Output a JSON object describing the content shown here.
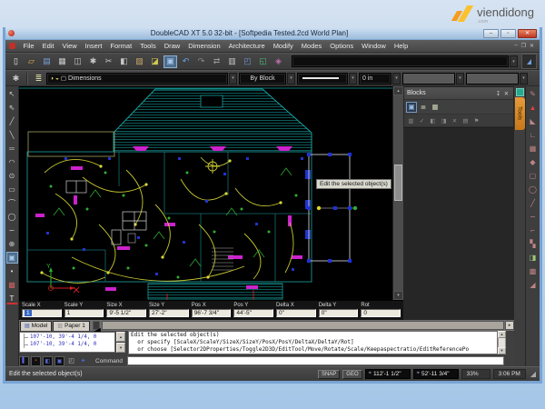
{
  "branding": {
    "name": "viendidong",
    "domain": ".com"
  },
  "window": {
    "title": "DoubleCAD XT 5.0 32-bit - [Softpedia Tested.2cd World Plan]"
  },
  "ui": {
    "up": "▴",
    "down": "▾",
    "left": "◂",
    "right": "▸",
    "grip": "◢",
    "coord_icon": "⌖",
    "pin": "↧",
    "close": "✕",
    "win_min": "–",
    "win_max": "▫",
    "win_close": "✕",
    "mdi_min": "–",
    "mdi_restore": "❐",
    "mdi_close": "✕",
    "dropdown": "▾"
  },
  "menu": {
    "items": [
      "File",
      "Edit",
      "View",
      "Insert",
      "Format",
      "Tools",
      "Draw",
      "Dimension",
      "Architecture",
      "Modify",
      "Modes",
      "Options",
      "Window",
      "Help"
    ]
  },
  "toolbar_main": {
    "icons": [
      {
        "name": "new",
        "glyph": "▯"
      },
      {
        "name": "open",
        "glyph": "▱"
      },
      {
        "name": "save",
        "glyph": "▤"
      },
      {
        "name": "print",
        "glyph": "▦"
      },
      {
        "name": "print-preview",
        "glyph": "◫"
      },
      {
        "name": "settings",
        "glyph": "✱"
      },
      {
        "name": "cut",
        "glyph": "✂"
      },
      {
        "name": "copy",
        "glyph": "◧"
      },
      {
        "name": "paste",
        "glyph": "▨"
      },
      {
        "name": "format-brush",
        "glyph": "◪"
      },
      {
        "name": "image",
        "glyph": "▣"
      },
      {
        "name": "undo",
        "glyph": "↶"
      },
      {
        "name": "redo",
        "glyph": "↷"
      },
      {
        "name": "insert-object",
        "glyph": "⇄"
      },
      {
        "name": "clipboard",
        "glyph": "▥"
      },
      {
        "name": "workspace",
        "glyph": "◰"
      },
      {
        "name": "render",
        "glyph": "◱"
      },
      {
        "name": "library",
        "glyph": "◈"
      }
    ],
    "selector_combo_value": ""
  },
  "toolbar_props": {
    "settings_glyph": "✱",
    "layers_glyph": "≣",
    "layer_combo": {
      "value": "Dimensions",
      "mini_icons": [
        "◑",
        "◒",
        "▢"
      ]
    },
    "color_combo": {
      "value": "By Block"
    },
    "pen_width_combo": {
      "value": "0 in"
    }
  },
  "left_toolbar": {
    "icons": [
      {
        "name": "select",
        "glyph": "↖"
      },
      {
        "name": "node-edit",
        "glyph": "⇖"
      },
      {
        "name": "line",
        "glyph": "╱"
      },
      {
        "name": "polyline",
        "glyph": "╲"
      },
      {
        "name": "multiline",
        "glyph": "═"
      },
      {
        "name": "arc",
        "glyph": "◠"
      },
      {
        "name": "center-circle",
        "glyph": "⊙"
      },
      {
        "name": "rectangle",
        "glyph": "▭"
      },
      {
        "name": "arc-3point",
        "glyph": "⌒"
      },
      {
        "name": "circle",
        "glyph": "◯"
      },
      {
        "name": "spline",
        "glyph": "∽"
      },
      {
        "name": "ellipse",
        "glyph": "⊕"
      },
      {
        "name": "image-tool",
        "glyph": "▣"
      },
      {
        "name": "point",
        "glyph": "•"
      },
      {
        "name": "block",
        "glyph": "▩"
      },
      {
        "name": "text",
        "glyph": "T"
      }
    ]
  },
  "right_toolbar": {
    "icons": [
      {
        "name": "pen",
        "glyph": "✎"
      },
      {
        "name": "warning",
        "glyph": "▲"
      },
      {
        "name": "corner",
        "glyph": "◣"
      },
      {
        "name": "angle",
        "glyph": "∟"
      },
      {
        "name": "grid",
        "glyph": "▦"
      },
      {
        "name": "diamond",
        "glyph": "◆"
      },
      {
        "name": "square",
        "glyph": "▢"
      },
      {
        "name": "circle",
        "glyph": "◯"
      },
      {
        "name": "slash",
        "glyph": "╱"
      },
      {
        "name": "wave",
        "glyph": "∽"
      },
      {
        "name": "bracket",
        "glyph": "⌐"
      },
      {
        "name": "blocks",
        "glyph": "▚"
      },
      {
        "name": "copy",
        "glyph": "◨"
      },
      {
        "name": "hatch",
        "glyph": "▩"
      },
      {
        "name": "corner2",
        "glyph": "◢"
      }
    ]
  },
  "canvas": {
    "tooltip": "Edit the selected object(s)"
  },
  "blocks_panel": {
    "title": "Blocks",
    "view_toolbar": [
      {
        "name": "thumbnail-view",
        "glyph": "▣"
      },
      {
        "name": "list-view",
        "glyph": "≣"
      },
      {
        "name": "detail-view",
        "glyph": "▦"
      }
    ],
    "edit_toolbar": [
      {
        "name": "edit-content",
        "glyph": "▥"
      },
      {
        "name": "confirm",
        "glyph": "✓"
      },
      {
        "name": "copy",
        "glyph": "◧"
      },
      {
        "name": "paste",
        "glyph": "◨"
      },
      {
        "name": "delete",
        "glyph": "✕"
      },
      {
        "name": "duplicate",
        "glyph": "▤"
      },
      {
        "name": "flag",
        "glyph": "⚑"
      }
    ]
  },
  "tools_tab": {
    "label": "Tools"
  },
  "inspector": {
    "fields": [
      {
        "label": "Scale X",
        "value": "1"
      },
      {
        "label": "Scale Y",
        "value": "1"
      },
      {
        "label": "Size X",
        "value": "9'-5 1/2\""
      },
      {
        "label": "Size Y",
        "value": "27'-2\""
      },
      {
        "label": "Pos X",
        "value": "96'-7 3/4\""
      },
      {
        "label": "Pos Y",
        "value": "44'-5\""
      },
      {
        "label": "Delta X",
        "value": "0\""
      },
      {
        "label": "Delta Y",
        "value": "0\""
      },
      {
        "label": "Rot",
        "value": "0"
      }
    ]
  },
  "sheet_tabs": {
    "tabs": [
      {
        "label": "Model",
        "icon": "▤"
      },
      {
        "label": "Paper 1",
        "icon": "▥"
      }
    ]
  },
  "history": {
    "items": [
      "107'-10, 39'-4 1/4, 0",
      "107'-10, 39'-4 1/4, 0"
    ]
  },
  "prompt": {
    "lines": [
      "Edit the selected object(s)",
      "  or specify [ScaleX/ScaleY/SizeX/SizeY/PosX/PosY/DeltaX/DeltaY/Rot]",
      "  or choose [Selector2DProperties/Toggle2D3D/EditTool/Move/Rotate/Scale/Keepaspectratio/EditReferencePo"
    ]
  },
  "command": {
    "label": "Command",
    "value": "",
    "buttons": [
      {
        "name": "cmd-style-1",
        "glyph": "▌"
      },
      {
        "name": "cmd-style-2",
        "glyph": "▪"
      },
      {
        "name": "cmd-style-3",
        "glyph": "◧"
      },
      {
        "name": "cmd-style-4",
        "glyph": "▣"
      }
    ],
    "extra": [
      {
        "name": "window-dot",
        "glyph": "◰"
      },
      {
        "name": "star",
        "glyph": "✦"
      }
    ]
  },
  "statusbar": {
    "message": "Edit the selected object(s)",
    "snap": "SNAP",
    "geo": "GEO",
    "coord_x": "112'-1 1/2\"",
    "coord_y": "52'-11 3/4\"",
    "zoom": "33%",
    "time": "3:06 PM"
  }
}
